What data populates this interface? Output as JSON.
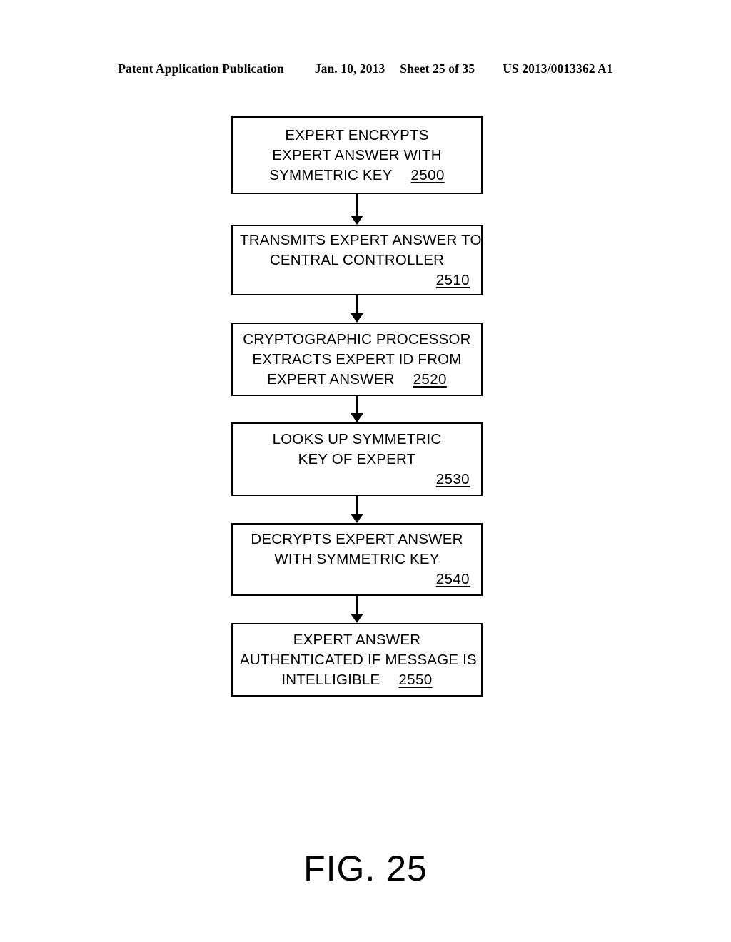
{
  "header": {
    "publication": "Patent Application Publication",
    "date": "Jan. 10, 2013",
    "sheet": "Sheet 25 of 35",
    "patent_number": "US 2013/0013362 A1"
  },
  "figure": {
    "caption": "FIG. 25",
    "steps": [
      {
        "lines": [
          "EXPERT ENCRYPTS",
          "EXPERT ANSWER WITH",
          "SYMMETRIC KEY"
        ],
        "ref": "2500",
        "ref_on_own_line": false
      },
      {
        "lines": [
          "TRANSMITS EXPERT ANSWER TO",
          "CENTRAL CONTROLLER"
        ],
        "ref": "2510",
        "ref_on_own_line": true
      },
      {
        "lines": [
          "CRYPTOGRAPHIC PROCESSOR",
          "EXTRACTS EXPERT ID FROM",
          "EXPERT ANSWER"
        ],
        "ref": "2520",
        "ref_on_own_line": false
      },
      {
        "lines": [
          "LOOKS UP SYMMETRIC",
          "KEY OF EXPERT"
        ],
        "ref": "2530",
        "ref_on_own_line": true
      },
      {
        "lines": [
          "DECRYPTS EXPERT ANSWER",
          "WITH SYMMETRIC KEY"
        ],
        "ref": "2540",
        "ref_on_own_line": true
      },
      {
        "lines": [
          "EXPERT ANSWER",
          "AUTHENTICATED IF MESSAGE IS",
          "INTELLIGIBLE"
        ],
        "ref": "2550",
        "ref_on_own_line": false
      }
    ],
    "arrow_icon": "down-arrow-icon",
    "colors": {
      "ink": "#000000",
      "paper": "#ffffff"
    }
  }
}
